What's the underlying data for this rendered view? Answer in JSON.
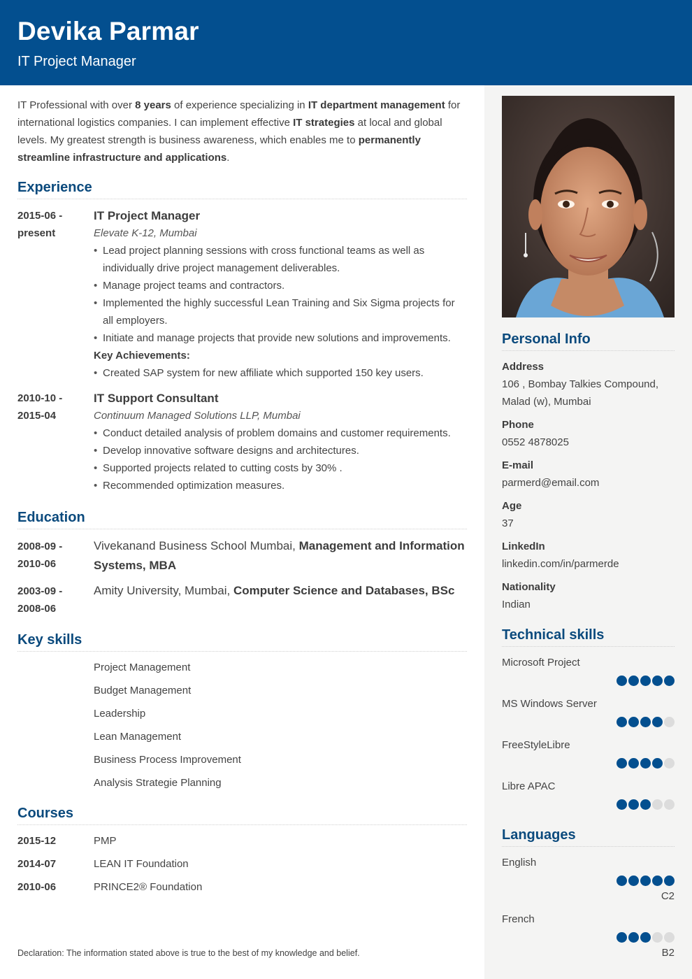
{
  "header": {
    "name": "Devika Parmar",
    "title": "IT Project Manager"
  },
  "colors": {
    "brand": "#034f8f",
    "section_title": "#0b4a7d",
    "sidebar_bg": "#f4f4f3",
    "dot_off": "#dcdcdc"
  },
  "summary": {
    "parts": [
      {
        "text": "IT Professional with over ",
        "bold": false
      },
      {
        "text": "8 years",
        "bold": true
      },
      {
        "text": " of experience specializing in ",
        "bold": false
      },
      {
        "text": "IT department management",
        "bold": true
      },
      {
        "text": " for international logistics companies. I can implement effective ",
        "bold": false
      },
      {
        "text": "IT strategies",
        "bold": true
      },
      {
        "text": " at local and global levels. My greatest strength is business awareness, which enables me to ",
        "bold": false
      },
      {
        "text": "permanently streamline infrastructure and applications",
        "bold": true
      },
      {
        "text": ".",
        "bold": false
      }
    ]
  },
  "experience": {
    "title": "Experience",
    "jobs": [
      {
        "date_start": "2015-06 -",
        "date_end": "present",
        "title": "IT Project Manager",
        "company": "Elevate K-12, Mumbai",
        "bullets": [
          "Lead project planning sessions with cross functional teams as well as individually drive project management deliverables.",
          "Manage project teams and contractors.",
          "Implemented the highly successful Lean Training and Six Sigma projects for all employers.",
          "Initiate and manage projects that provide new solutions and improvements."
        ],
        "achievements_label": "Key Achievements:",
        "achievements": [
          "Created SAP system for new affiliate which supported 150 key users."
        ]
      },
      {
        "date_start": "2010-10 -",
        "date_end": "2015-04",
        "title": "IT Support Consultant",
        "company": "Continuum Managed Solutions LLP, Mumbai",
        "bullets": [
          "Conduct detailed analysis of problem domains and customer requirements.",
          "Develop innovative software designs and architectures.",
          "Supported projects related to cutting costs by 30% .",
          "Recommended optimization measures."
        ]
      }
    ]
  },
  "education": {
    "title": "Education",
    "items": [
      {
        "date_start": "2008-09 -",
        "date_end": "2010-06",
        "school": "Vivekanand Business School Mumbai, ",
        "degree": "Management and Information Systems, MBA"
      },
      {
        "date_start": "2003-09 -",
        "date_end": "2008-06",
        "school": "Amity University, Mumbai, ",
        "degree": "Computer Science and Databases, BSc"
      }
    ]
  },
  "key_skills": {
    "title": "Key skills",
    "items": [
      "Project Management",
      "Budget Management",
      "Leadership",
      "Lean Management",
      "Business Process Improvement",
      "Analysis Strategie Planning"
    ]
  },
  "courses": {
    "title": "Courses",
    "items": [
      {
        "date": "2015-12",
        "name": "PMP"
      },
      {
        "date": "2014-07",
        "name": "LEAN IT Foundation"
      },
      {
        "date": "2010-06",
        "name": "PRINCE2® Foundation"
      }
    ]
  },
  "declaration": "Declaration: The information stated above is true to the best of my knowledge and belief.",
  "sidebar": {
    "photo_alt": "Portrait photo of Devika Parmar",
    "personal_info": {
      "title": "Personal Info",
      "fields": [
        {
          "label": "Address",
          "value": "106 , Bombay Talkies Compound, Malad (w), Mumbai"
        },
        {
          "label": "Phone",
          "value": "0552 4878025"
        },
        {
          "label": "E-mail",
          "value": "parmerd@email.com"
        },
        {
          "label": "Age",
          "value": "37"
        },
        {
          "label": "LinkedIn",
          "value": "linkedin.com/in/parmerde"
        },
        {
          "label": "Nationality",
          "value": "Indian"
        }
      ]
    },
    "technical_skills": {
      "title": "Technical skills",
      "max_level": 5,
      "items": [
        {
          "name": "Microsoft Project",
          "level": 5
        },
        {
          "name": "MS Windows Server",
          "level": 4
        },
        {
          "name": "FreeStyleLibre",
          "level": 4
        },
        {
          "name": "Libre APAC",
          "level": 3
        }
      ]
    },
    "languages": {
      "title": "Languages",
      "max_level": 5,
      "items": [
        {
          "name": "English",
          "level": 5,
          "cefr": "C2"
        },
        {
          "name": "French",
          "level": 3,
          "cefr": "B2"
        }
      ]
    }
  }
}
